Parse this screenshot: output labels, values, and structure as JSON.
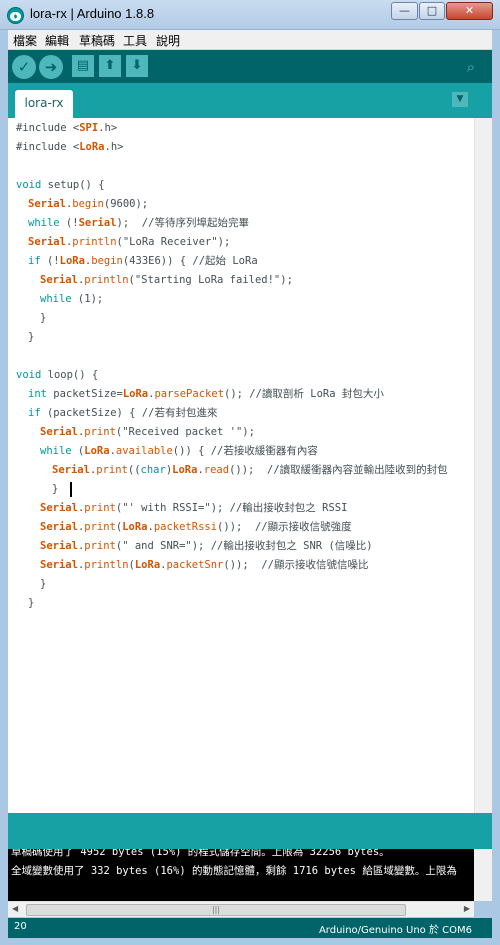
{
  "window": {
    "title": "lora-rx | Arduino 1.8.8",
    "minimize": "—",
    "maximize": "□",
    "close": "✕"
  },
  "menu": [
    "檔案",
    "編輯",
    "草稿碼",
    "工具",
    "說明"
  ],
  "toolbar": {
    "verify": "✓",
    "upload": "➜",
    "new": "▤",
    "open": "⬆",
    "save": "⬇",
    "serial_monitor": "⌕"
  },
  "tab": {
    "name": "lora-rx",
    "menu_arrow": "▼"
  },
  "code": {
    "l1a": "#include <",
    "l1b": "SPI",
    "l1c": ".h>",
    "l2a": "#include <",
    "l2b": "LoRa",
    "l2c": ".h>",
    "l4a": "void",
    "l4b": " setup() {",
    "l5a": "Serial",
    "l5b": ".",
    "l5c": "begin",
    "l5d": "(9600);",
    "l6a": "while",
    "l6b": " (!",
    "l6c": "Serial",
    "l6d": ");  //等待序列埠起始完畢",
    "l7a": "Serial",
    "l7b": ".",
    "l7c": "println",
    "l7d": "(\"LoRa Receiver\");",
    "l8a": "if",
    "l8b": " (!",
    "l8c": "LoRa",
    "l8d": ".",
    "l8e": "begin",
    "l8f": "(433E6)) { //起始 LoRa",
    "l9a": "Serial",
    "l9b": ".",
    "l9c": "println",
    "l9d": "(\"Starting LoRa failed!\");",
    "l10a": "while",
    "l10b": " (1);",
    "l11": "}",
    "l12": "}",
    "l14a": "void",
    "l14b": " loop() {",
    "l15a": "int",
    "l15b": " packetSize=",
    "l15c": "LoRa",
    "l15d": ".",
    "l15e": "parsePacket",
    "l15f": "(); //讀取剖析 LoRa 封包大小",
    "l16a": "if",
    "l16b": " (packetSize) { //若有封包進來",
    "l17a": "Serial",
    "l17b": ".",
    "l17c": "print",
    "l17d": "(\"Received packet '\");",
    "l18a": "while",
    "l18b": " (",
    "l18c": "LoRa",
    "l18d": ".",
    "l18e": "available",
    "l18f": "()) { //若接收緩衝器有內容",
    "l19a": "Serial",
    "l19b": ".",
    "l19c": "print",
    "l19d": "((",
    "l19e": "char",
    "l19f": ")",
    "l19g": "LoRa",
    "l19h": ".",
    "l19i": "read",
    "l19j": "());  //讀取緩衝器內容並輸出陸收到的封包",
    "l20": "}",
    "l21a": "Serial",
    "l21b": ".",
    "l21c": "print",
    "l21d": "(\"' with RSSI=\"); //輸出接收封包之 RSSI",
    "l22a": "Serial",
    "l22b": ".",
    "l22c": "print",
    "l22d": "(",
    "l22e": "LoRa",
    "l22f": ".",
    "l22g": "packetRssi",
    "l22h": "());  //顯示接收信號強度",
    "l23a": "Serial",
    "l23b": ".",
    "l23c": "print",
    "l23d": "(\" and SNR=\"); //輸出接收封包之 SNR (信噪比)",
    "l24a": "Serial",
    "l24b": ".",
    "l24c": "println",
    "l24d": "(",
    "l24e": "LoRa",
    "l24f": ".",
    "l24g": "packetSnr",
    "l24h": "());  //顯示接收信號信噪比",
    "l25": "}",
    "l26": "}"
  },
  "console": {
    "line1": "草稿碼使用了 4952 bytes (15%) 的程式儲存空間。上限為 32256 bytes。",
    "line2": "全域變數使用了 332 bytes (16%) 的動態記憶體，剩餘 1716 bytes 給區域變數。上限為"
  },
  "hscroll": {
    "left": "◀",
    "right": "▶",
    "grip": "|||"
  },
  "footer": {
    "line": "20",
    "board": "Arduino/Genuino Uno 於 COM6"
  }
}
